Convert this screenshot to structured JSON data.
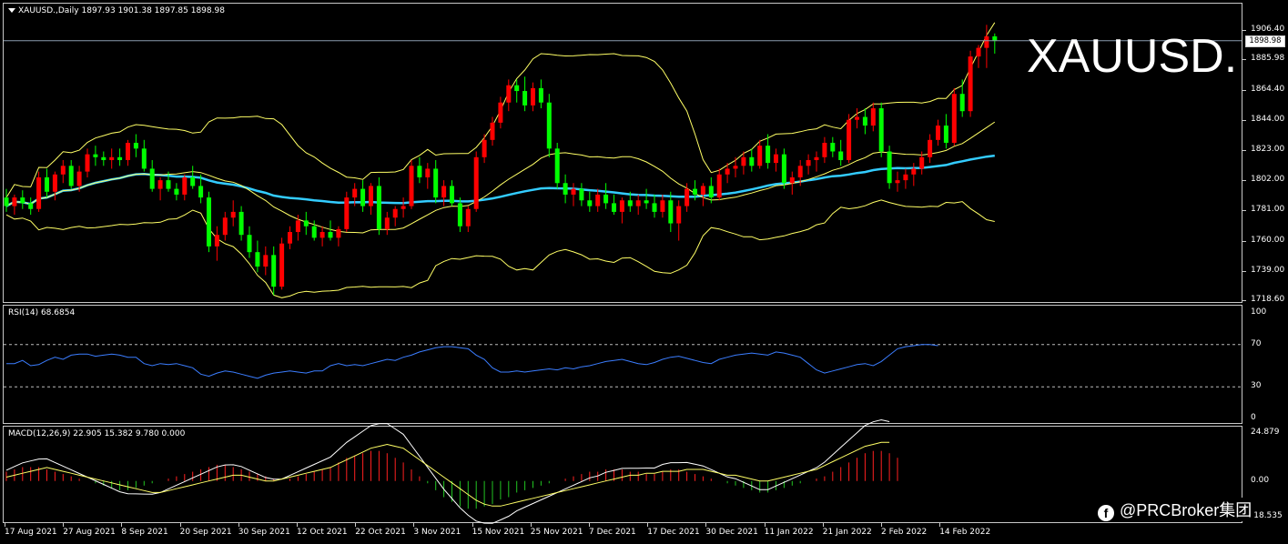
{
  "header": {
    "symbol_info": "XAUUSD.,Daily  1897.93 1901.38 1897.85 1898.98"
  },
  "watermark": "XAUUSD.",
  "current_price": "1898.98",
  "price_axis": [
    "1906.40",
    "1885.98",
    "1864.40",
    "1844.00",
    "1823.00",
    "1802.00",
    "1781.00",
    "1760.00",
    "1739.00",
    "1718.60"
  ],
  "rsi": {
    "label": "RSI(14) 68.6854",
    "axis": [
      "100",
      "70",
      "30",
      "0"
    ]
  },
  "macd": {
    "label": "MACD(12,26,9) 22.905 15.382 9.780 0.000",
    "axis": [
      "24.879",
      "0.00",
      "-18.535"
    ]
  },
  "dates": [
    "17 Aug 2021",
    "27 Aug 2021",
    "8 Sep 2021",
    "20 Sep 2021",
    "30 Sep 2021",
    "12 Oct 2021",
    "22 Oct 2021",
    "3 Nov 2021",
    "15 Nov 2021",
    "25 Nov 2021",
    "7 Dec 2021",
    "17 Dec 2021",
    "30 Dec 2021",
    "11 Jan 2022",
    "21 Jan 2022",
    "2 Feb 2022",
    "14 Feb 2022"
  ],
  "brand": {
    "text": "@PRCBroker集团",
    "icon": "facebook-icon"
  },
  "colors": {
    "bull": "#ff0000",
    "bear": "#00ff00",
    "band": "#ffff66",
    "ma": "#33ccff",
    "rsi": "#3b7dff",
    "macd_main": "#ffffff",
    "macd_signal": "#ffff66"
  },
  "chart_data": [
    {
      "type": "candlestick",
      "title": "XAUUSD.,Daily",
      "ylim": [
        1718.6,
        1906.4
      ],
      "ohlc": [
        [
          1790,
          1796,
          1780,
          1784
        ],
        [
          1784,
          1792,
          1778,
          1790
        ],
        [
          1790,
          1795,
          1782,
          1786
        ],
        [
          1786,
          1790,
          1778,
          1782
        ],
        [
          1782,
          1808,
          1780,
          1804
        ],
        [
          1804,
          1810,
          1790,
          1794
        ],
        [
          1794,
          1808,
          1788,
          1806
        ],
        [
          1806,
          1816,
          1800,
          1812
        ],
        [
          1812,
          1816,
          1796,
          1798
        ],
        [
          1798,
          1812,
          1794,
          1808
        ],
        [
          1808,
          1824,
          1804,
          1820
        ],
        [
          1820,
          1826,
          1812,
          1818
        ],
        [
          1818,
          1822,
          1812,
          1816
        ],
        [
          1816,
          1824,
          1810,
          1818
        ],
        [
          1818,
          1824,
          1812,
          1816
        ],
        [
          1816,
          1830,
          1812,
          1828
        ],
        [
          1828,
          1834,
          1818,
          1824
        ],
        [
          1824,
          1830,
          1808,
          1810
        ],
        [
          1810,
          1816,
          1794,
          1796
        ],
        [
          1796,
          1804,
          1788,
          1802
        ],
        [
          1802,
          1808,
          1794,
          1796
        ],
        [
          1796,
          1800,
          1788,
          1792
        ],
        [
          1792,
          1806,
          1788,
          1804
        ],
        [
          1804,
          1812,
          1796,
          1798
        ],
        [
          1798,
          1806,
          1786,
          1790
        ],
        [
          1790,
          1794,
          1752,
          1756
        ],
        [
          1756,
          1770,
          1746,
          1764
        ],
        [
          1764,
          1780,
          1760,
          1776
        ],
        [
          1776,
          1788,
          1770,
          1780
        ],
        [
          1780,
          1784,
          1760,
          1764
        ],
        [
          1764,
          1770,
          1748,
          1752
        ],
        [
          1752,
          1760,
          1738,
          1742
        ],
        [
          1742,
          1756,
          1736,
          1750
        ],
        [
          1750,
          1756,
          1722,
          1728
        ],
        [
          1728,
          1762,
          1726,
          1758
        ],
        [
          1758,
          1770,
          1754,
          1766
        ],
        [
          1766,
          1778,
          1760,
          1774
        ],
        [
          1774,
          1780,
          1764,
          1770
        ],
        [
          1770,
          1774,
          1760,
          1762
        ],
        [
          1762,
          1770,
          1756,
          1766
        ],
        [
          1766,
          1774,
          1760,
          1762
        ],
        [
          1762,
          1770,
          1756,
          1768
        ],
        [
          1768,
          1794,
          1766,
          1790
        ],
        [
          1790,
          1800,
          1784,
          1796
        ],
        [
          1796,
          1802,
          1780,
          1784
        ],
        [
          1784,
          1800,
          1778,
          1798
        ],
        [
          1798,
          1804,
          1764,
          1768
        ],
        [
          1768,
          1780,
          1764,
          1776
        ],
        [
          1776,
          1784,
          1770,
          1782
        ],
        [
          1782,
          1790,
          1776,
          1784
        ],
        [
          1784,
          1816,
          1782,
          1812
        ],
        [
          1812,
          1818,
          1800,
          1804
        ],
        [
          1804,
          1814,
          1796,
          1810
        ],
        [
          1810,
          1816,
          1786,
          1790
        ],
        [
          1790,
          1802,
          1784,
          1798
        ],
        [
          1798,
          1802,
          1784,
          1786
        ],
        [
          1786,
          1790,
          1766,
          1770
        ],
        [
          1770,
          1784,
          1766,
          1782
        ],
        [
          1782,
          1822,
          1780,
          1818
        ],
        [
          1818,
          1834,
          1814,
          1830
        ],
        [
          1830,
          1846,
          1826,
          1842
        ],
        [
          1842,
          1860,
          1838,
          1856
        ],
        [
          1856,
          1872,
          1850,
          1868
        ],
        [
          1868,
          1872,
          1856,
          1864
        ],
        [
          1864,
          1874,
          1850,
          1854
        ],
        [
          1854,
          1870,
          1850,
          1866
        ],
        [
          1866,
          1872,
          1852,
          1856
        ],
        [
          1856,
          1862,
          1818,
          1824
        ],
        [
          1824,
          1828,
          1796,
          1800
        ],
        [
          1800,
          1806,
          1786,
          1792
        ],
        [
          1792,
          1800,
          1784,
          1796
        ],
        [
          1796,
          1800,
          1784,
          1788
        ],
        [
          1788,
          1794,
          1780,
          1784
        ],
        [
          1784,
          1796,
          1780,
          1792
        ],
        [
          1792,
          1800,
          1782,
          1786
        ],
        [
          1786,
          1792,
          1778,
          1780
        ],
        [
          1780,
          1790,
          1772,
          1788
        ],
        [
          1788,
          1794,
          1780,
          1784
        ],
        [
          1784,
          1792,
          1778,
          1788
        ],
        [
          1788,
          1796,
          1782,
          1786
        ],
        [
          1786,
          1792,
          1776,
          1780
        ],
        [
          1780,
          1792,
          1776,
          1788
        ],
        [
          1788,
          1794,
          1766,
          1772
        ],
        [
          1772,
          1788,
          1760,
          1784
        ],
        [
          1784,
          1800,
          1780,
          1796
        ],
        [
          1796,
          1802,
          1788,
          1792
        ],
        [
          1792,
          1800,
          1784,
          1798
        ],
        [
          1798,
          1804,
          1786,
          1790
        ],
        [
          1790,
          1810,
          1788,
          1806
        ],
        [
          1806,
          1814,
          1800,
          1810
        ],
        [
          1810,
          1818,
          1804,
          1812
        ],
        [
          1812,
          1822,
          1806,
          1818
        ],
        [
          1818,
          1824,
          1808,
          1812
        ],
        [
          1812,
          1830,
          1810,
          1826
        ],
        [
          1826,
          1834,
          1810,
          1814
        ],
        [
          1814,
          1824,
          1808,
          1820
        ],
        [
          1820,
          1824,
          1796,
          1800
        ],
        [
          1800,
          1808,
          1792,
          1804
        ],
        [
          1804,
          1816,
          1798,
          1812
        ],
        [
          1812,
          1820,
          1806,
          1816
        ],
        [
          1816,
          1822,
          1808,
          1818
        ],
        [
          1818,
          1832,
          1814,
          1828
        ],
        [
          1828,
          1832,
          1818,
          1822
        ],
        [
          1822,
          1830,
          1812,
          1816
        ],
        [
          1816,
          1848,
          1814,
          1844
        ],
        [
          1844,
          1852,
          1838,
          1846
        ],
        [
          1846,
          1852,
          1834,
          1840
        ],
        [
          1840,
          1856,
          1836,
          1852
        ],
        [
          1852,
          1856,
          1818,
          1822
        ],
        [
          1822,
          1826,
          1796,
          1800
        ],
        [
          1800,
          1808,
          1794,
          1802
        ],
        [
          1802,
          1810,
          1796,
          1806
        ],
        [
          1806,
          1814,
          1798,
          1810
        ],
        [
          1810,
          1822,
          1806,
          1818
        ],
        [
          1818,
          1834,
          1814,
          1830
        ],
        [
          1830,
          1844,
          1826,
          1840
        ],
        [
          1840,
          1848,
          1824,
          1828
        ],
        [
          1828,
          1866,
          1826,
          1862
        ],
        [
          1862,
          1872,
          1846,
          1850
        ],
        [
          1850,
          1892,
          1846,
          1888
        ],
        [
          1888,
          1896,
          1880,
          1894
        ],
        [
          1894,
          1910,
          1880,
          1902
        ],
        [
          1902,
          1904,
          1890,
          1899
        ]
      ]
    },
    {
      "type": "line",
      "title": "RSI(14) 68.6854",
      "ylim": [
        0,
        100
      ],
      "levels": [
        70,
        30
      ],
      "values": [
        52,
        52,
        55,
        50,
        51,
        55,
        58,
        56,
        60,
        61,
        61,
        59,
        60,
        61,
        60,
        58,
        58,
        52,
        50,
        52,
        51,
        52,
        50,
        48,
        42,
        40,
        43,
        45,
        44,
        42,
        40,
        38,
        41,
        43,
        44,
        45,
        44,
        43,
        45,
        45,
        50,
        52,
        50,
        51,
        50,
        52,
        54,
        56,
        55,
        58,
        60,
        63,
        65,
        67,
        68,
        68,
        67,
        66,
        60,
        56,
        48,
        44,
        44,
        45,
        44,
        45,
        46,
        47,
        46,
        48,
        47,
        49,
        50,
        52,
        54,
        55,
        56,
        54,
        52,
        51,
        53,
        56,
        58,
        59,
        57,
        55,
        53,
        52,
        56,
        58,
        60,
        61,
        62,
        61,
        60,
        63,
        62,
        60,
        58,
        52,
        46,
        43,
        45,
        47,
        49,
        51,
        52,
        50,
        54,
        60,
        66,
        68,
        69,
        70,
        70,
        69
      ]
    },
    {
      "type": "bar",
      "title": "MACD(12,26,9) 22.905 15.382 9.780 0.000",
      "ylim": [
        -18.535,
        24.879
      ],
      "series": [
        {
          "values": [
            4,
            5,
            6,
            6,
            6,
            5,
            4,
            3,
            2,
            1,
            0,
            -1,
            -2,
            -3,
            -4,
            -4,
            -3,
            -2,
            -1,
            0,
            1,
            2,
            3,
            4,
            5,
            6,
            7,
            7,
            6,
            5,
            4,
            3,
            2,
            1,
            0,
            1,
            2,
            3,
            4,
            5,
            6,
            8,
            10,
            11,
            12,
            13,
            13,
            12,
            10,
            8,
            5,
            2,
            -1,
            -4,
            -7,
            -9,
            -11,
            -12,
            -12,
            -11,
            -10,
            -8,
            -7,
            -5,
            -4,
            -3,
            -2,
            -1,
            0,
            1,
            2,
            3,
            4,
            4,
            5,
            5,
            5,
            4,
            4,
            3,
            3,
            4,
            5,
            5,
            4,
            3,
            2,
            1,
            0,
            -1,
            -2,
            -3,
            -4,
            -5,
            -5,
            -4,
            -3,
            -2,
            -1,
            0,
            1,
            2,
            4,
            6,
            8,
            10,
            12,
            13,
            13,
            12,
            10
          ]
        },
        {
          "values": [
            2,
            3,
            4,
            5,
            6,
            7,
            6,
            5,
            4,
            3,
            2,
            1,
            0,
            -1,
            -2,
            -3,
            -4,
            -5,
            -6,
            -6,
            -5,
            -4,
            -3,
            -2,
            -1,
            0,
            1,
            2,
            3,
            3,
            2,
            1,
            0,
            0,
            1,
            2,
            3,
            4,
            5,
            6,
            7,
            9,
            11,
            13,
            15,
            17,
            18,
            19,
            18,
            17,
            14,
            11,
            8,
            5,
            2,
            -1,
            -4,
            -7,
            -10,
            -12,
            -13,
            -13,
            -12,
            -11,
            -10,
            -9,
            -8,
            -7,
            -6,
            -5,
            -4,
            -3,
            -2,
            -1,
            0,
            1,
            2,
            3,
            3,
            4,
            4,
            5,
            5,
            5,
            6,
            6,
            6,
            5,
            4,
            3,
            3,
            2,
            1,
            0,
            0,
            1,
            2,
            3,
            4,
            5,
            6,
            8,
            10,
            12,
            14,
            16,
            18,
            19,
            20,
            20
          ]
        }
      ]
    }
  ]
}
